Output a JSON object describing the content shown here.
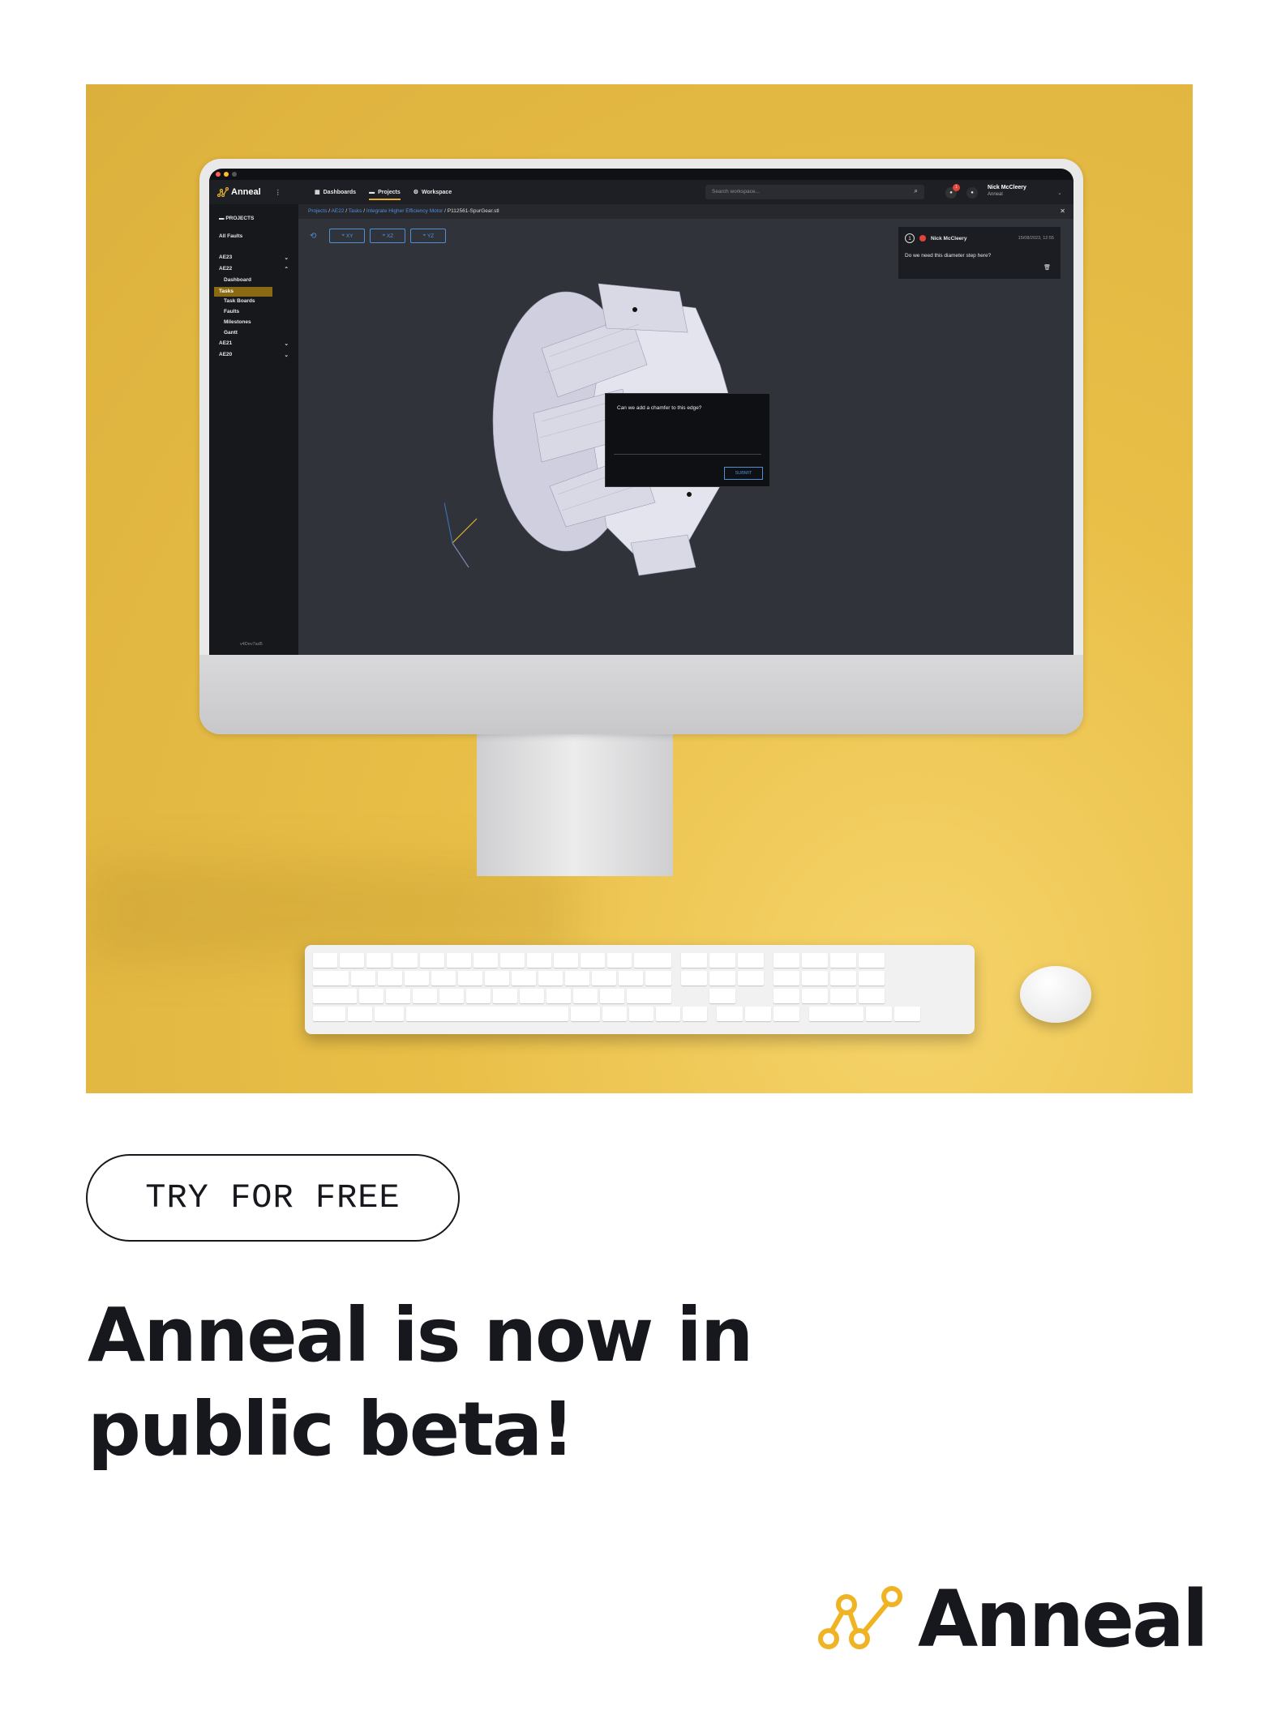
{
  "app": {
    "brand": "Anneal",
    "nav": [
      {
        "label": "Dashboards",
        "active": false
      },
      {
        "label": "Projects",
        "active": true
      },
      {
        "label": "Workspace",
        "active": false
      }
    ],
    "search_placeholder": "Search workspace...",
    "user": {
      "name": "Nick McCleery",
      "org": "Anneal"
    },
    "notification_count": "1",
    "sidebar": {
      "header": "PROJECTS",
      "all_faults": "All Faults",
      "groups": [
        {
          "label": "AE23",
          "expanded": false
        },
        {
          "label": "AE22",
          "expanded": true
        }
      ],
      "subitems": [
        {
          "label": "Dashboard",
          "active": false
        },
        {
          "label": "Tasks",
          "active": true
        },
        {
          "label": "Task Boards",
          "active": false
        },
        {
          "label": "Faults",
          "active": false
        },
        {
          "label": "Milestones",
          "active": false
        },
        {
          "label": "Gantt",
          "active": false
        }
      ],
      "more_groups": [
        {
          "label": "AE21"
        },
        {
          "label": "AE20"
        }
      ],
      "footer": "v4Dev7ad5"
    },
    "breadcrumb": {
      "links": [
        "Projects",
        "AE22",
        "Tasks",
        "Integrate Higher Efficiency Motor"
      ],
      "current": "P112561-SpurGear.stl"
    },
    "view_buttons": [
      "XY",
      "XZ",
      "YZ"
    ],
    "comment": {
      "index": "1",
      "author": "Nick McCleery",
      "timestamp": "15/08/2023, 12:55",
      "text": "Do we need this diameter step here?"
    },
    "dialog": {
      "prompt": "Can we add a chamfer to this edge?",
      "submit": "SUBMIT"
    },
    "colors": {
      "accent": "#E2AE2C",
      "link": "#4F8FD8",
      "bg": "#30333A"
    }
  },
  "cta": {
    "label": "TRY FOR FREE"
  },
  "headline": {
    "line1": "Anneal is now in",
    "line2": "public beta!"
  },
  "brand": {
    "name": "Anneal",
    "logo_color": "#F0B323"
  }
}
